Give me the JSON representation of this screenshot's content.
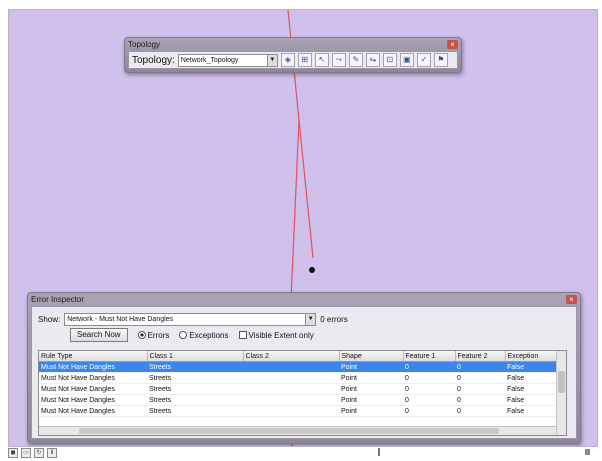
{
  "topology_toolbar": {
    "title": "Topology",
    "label": "Topology:",
    "selected_topology": "Network_Topology",
    "tools": [
      "construct-features-icon",
      "planarize-icon",
      "topology-edit-icon",
      "modify-edge-icon",
      "reshape-edge-icon",
      "align-edge-icon",
      "validate-extent-icon",
      "validate-visible-icon",
      "fix-error-icon",
      "error-inspector-icon"
    ]
  },
  "error_inspector": {
    "title": "Error Inspector",
    "show_label": "Show:",
    "show_value": "Network - Must Not Have Dangles",
    "errors_label": "0 errors",
    "search_now_label": "Search Now",
    "errors_option": "Errors",
    "exceptions_option": "Exceptions",
    "visible_extent_only": "Visible Extent only",
    "columns": [
      "Rule Type",
      "Class 1",
      "Class 2",
      "Shape",
      "Feature 1",
      "Feature 2",
      "Exception"
    ],
    "rows": [
      [
        "Must Not Have Dangles",
        "Streets",
        "",
        "Point",
        "0",
        "0",
        "False"
      ],
      [
        "Must Not Have Dangles",
        "Streets",
        "",
        "Point",
        "0",
        "0",
        "False"
      ],
      [
        "Must Not Have Dangles",
        "Streets",
        "",
        "Point",
        "0",
        "0",
        "False"
      ],
      [
        "Must Not Have Dangles",
        "Streets",
        "",
        "Point",
        "0",
        "0",
        "False"
      ],
      [
        "Must Not Have Dangles",
        "Streets",
        "",
        "Point",
        "0",
        "0",
        "False"
      ]
    ],
    "selected_row": 0
  },
  "colors": {
    "map_background": "#cfc0ec",
    "line_color": "#e8505a",
    "selection": "#3b86e6"
  }
}
